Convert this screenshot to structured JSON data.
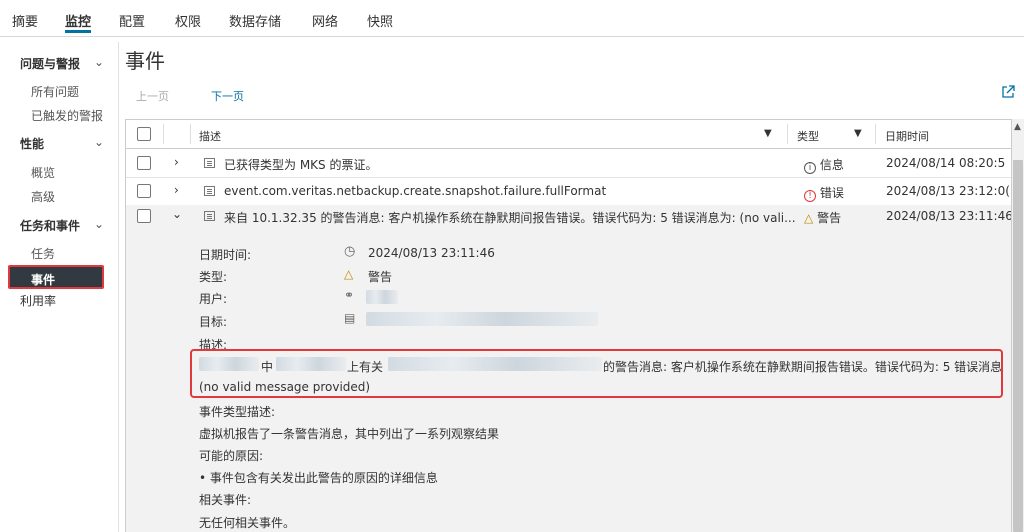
{
  "top_tabs": [
    "摘要",
    "监控",
    "配置",
    "权限",
    "数据存储",
    "网络",
    "快照"
  ],
  "sidebar": {
    "sections": [
      {
        "label": "问题与警报",
        "items": [
          "所有问题",
          "已触发的警报"
        ]
      },
      {
        "label": "性能",
        "items": [
          "概览",
          "高级"
        ]
      },
      {
        "label": "任务和事件",
        "items": [
          "任务",
          "事件"
        ]
      }
    ],
    "other": "利用率"
  },
  "page_title": "事件",
  "pager": {
    "prev": "上一页",
    "next": "下一页"
  },
  "table": {
    "headers": {
      "description": "描述",
      "type": "类型",
      "datetime": "日期时间"
    },
    "rows": [
      {
        "description": "已获得类型为 MKS 的票证。",
        "type": "信息",
        "datetime": "2024/08/14 08:20:5"
      },
      {
        "description": "event.com.veritas.netbackup.create.snapshot.failure.fullFormat",
        "type": "错误",
        "datetime": "2024/08/13 23:12:0("
      },
      {
        "description": "来自 10.1.32.35 的警告消息: 客户机操作系统在静默期间报告错误。错误代码为: 5 错误消息为: (no vali...",
        "type": "警告",
        "datetime": "2024/08/13 23:11:46"
      }
    ]
  },
  "detail": {
    "datetime_label": "日期时间:",
    "datetime_value": "2024/08/13 23:11:46",
    "type_label": "类型:",
    "type_value": "警告",
    "user_label": "用户:",
    "target_label": "目标:",
    "desc_label": "描述:",
    "desc_part1": "中",
    "desc_part2": "上有关",
    "desc_part3": "的警告消息: 客户机操作系统在静默期间报告错误。错误代码为: 5 错误消息",
    "desc_line2": "(no valid message provided)",
    "event_type_desc_label": "事件类型描述:",
    "event_type_desc": "虚拟机报告了一条警告消息，其中列出了一系列观察结果",
    "causes_label": "可能的原因:",
    "cause_1": "事件包含有关发出此警告的原因的详细信息",
    "related_label": "相关事件:",
    "related_value": "无任何相关事件。"
  },
  "colors": {
    "accent": "#0072a3",
    "selected_bg": "#313a41",
    "highlight": "#e0393e",
    "error": "#e0393e",
    "warning": "#c08a00"
  }
}
